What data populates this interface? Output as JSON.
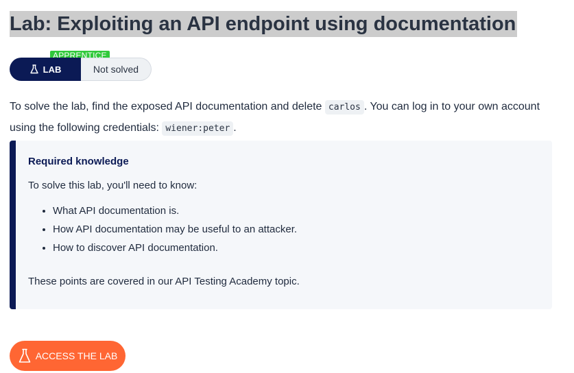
{
  "title": "Lab: Exploiting an API endpoint using documentation",
  "badge": {
    "level": "APPRENTICE",
    "lab_label": "LAB",
    "lab_icon": "flask-icon",
    "status": "Not solved"
  },
  "intro": {
    "part1": "To solve the lab, find the exposed API documentation and delete ",
    "code1": "carlos",
    "part2": ". You can log in to your own account using the following credentials: ",
    "code2": "wiener:peter",
    "part3": "."
  },
  "callout": {
    "title": "Required knowledge",
    "lead": "To solve this lab, you'll need to know:",
    "items": [
      "What API documentation is.",
      "How API documentation may be useful to an attacker.",
      "How to discover API documentation."
    ],
    "footer": "These points are covered in our API Testing Academy topic."
  },
  "access_button": {
    "label": "ACCESS THE LAB",
    "icon": "flask-icon"
  },
  "colors": {
    "navy": "#0b1a55",
    "apprentice_green": "#30c93b",
    "accent_orange": "#ff6633",
    "title_highlight": "#cccccc",
    "callout_bg": "#f5f7fa"
  }
}
